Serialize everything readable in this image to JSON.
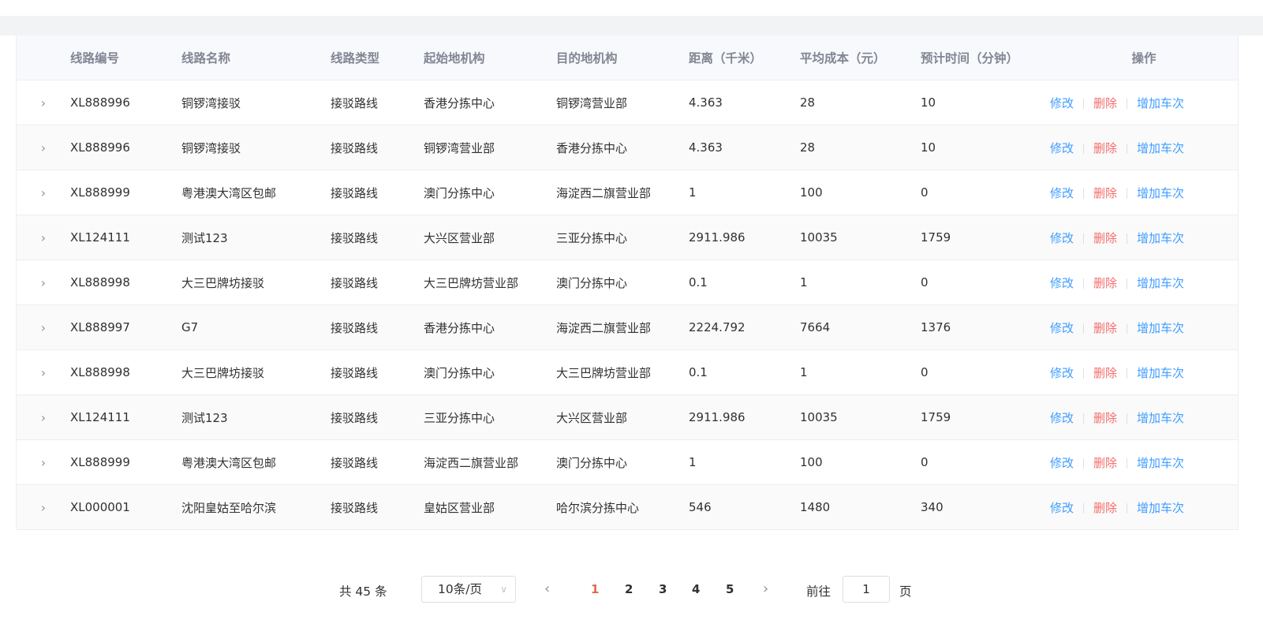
{
  "table": {
    "headers": [
      "线路编号",
      "线路名称",
      "线路类型",
      "起始地机构",
      "目的地机构",
      "距离（千米）",
      "平均成本（元）",
      "预计时间（分钟）",
      "操作"
    ],
    "rows": [
      {
        "id": "XL888996",
        "name": "铜锣湾接驳",
        "type": "接驳路线",
        "from": "香港分拣中心",
        "to": "铜锣湾营业部",
        "distance": "4.363",
        "cost": "28",
        "time": "10"
      },
      {
        "id": "XL888996",
        "name": "铜锣湾接驳",
        "type": "接驳路线",
        "from": "铜锣湾营业部",
        "to": "香港分拣中心",
        "distance": "4.363",
        "cost": "28",
        "time": "10"
      },
      {
        "id": "XL888999",
        "name": "粤港澳大湾区包邮",
        "type": "接驳路线",
        "from": "澳门分拣中心",
        "to": "海淀西二旗营业部",
        "distance": "1",
        "cost": "100",
        "time": "0"
      },
      {
        "id": "XL124111",
        "name": "测试123",
        "type": "接驳路线",
        "from": "大兴区营业部",
        "to": "三亚分拣中心",
        "distance": "2911.986",
        "cost": "10035",
        "time": "1759"
      },
      {
        "id": "XL888998",
        "name": "大三巴牌坊接驳",
        "type": "接驳路线",
        "from": "大三巴牌坊营业部",
        "to": "澳门分拣中心",
        "distance": "0.1",
        "cost": "1",
        "time": "0"
      },
      {
        "id": "XL888997",
        "name": "G7",
        "type": "接驳路线",
        "from": "香港分拣中心",
        "to": "海淀西二旗营业部",
        "distance": "2224.792",
        "cost": "7664",
        "time": "1376"
      },
      {
        "id": "XL888998",
        "name": "大三巴牌坊接驳",
        "type": "接驳路线",
        "from": "澳门分拣中心",
        "to": "大三巴牌坊营业部",
        "distance": "0.1",
        "cost": "1",
        "time": "0"
      },
      {
        "id": "XL124111",
        "name": "测试123",
        "type": "接驳路线",
        "from": "三亚分拣中心",
        "to": "大兴区营业部",
        "distance": "2911.986",
        "cost": "10035",
        "time": "1759"
      },
      {
        "id": "XL888999",
        "name": "粤港澳大湾区包邮",
        "type": "接驳路线",
        "from": "海淀西二旗营业部",
        "to": "澳门分拣中心",
        "distance": "1",
        "cost": "100",
        "time": "0"
      },
      {
        "id": "XL000001",
        "name": "沈阳皇姑至哈尔滨",
        "type": "接驳路线",
        "from": "皇姑区营业部",
        "to": "哈尔滨分拣中心",
        "distance": "546",
        "cost": "1480",
        "time": "340"
      }
    ],
    "actions": {
      "edit": "修改",
      "delete": "删除",
      "add_trip": "增加车次"
    },
    "expand_icon": "›"
  },
  "pagination": {
    "total_text": "共 45 条",
    "page_size": "10条/页",
    "pages": [
      "1",
      "2",
      "3",
      "4",
      "5"
    ],
    "current_page": "1",
    "prev_icon": "‹",
    "next_icon": "›",
    "goto_label": "前往",
    "goto_value": "1",
    "page_label": "页",
    "caret_icon": "∨"
  },
  "colors": {
    "link": "#409eff",
    "danger": "#f56c6c",
    "active_page": "#e06a49"
  }
}
